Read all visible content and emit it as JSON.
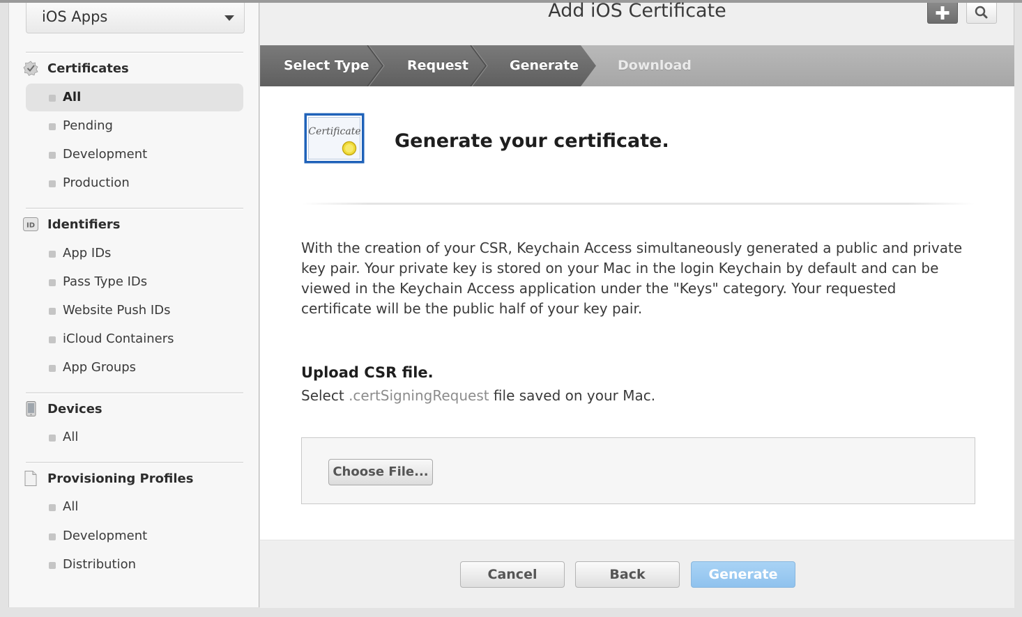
{
  "sidebar": {
    "app_selector": "iOS Apps",
    "sections": {
      "certificates": {
        "title": "Certificates",
        "items": [
          "All",
          "Pending",
          "Development",
          "Production"
        ]
      },
      "identifiers": {
        "title": "Identifiers",
        "icon_text": "ID",
        "items": [
          "App IDs",
          "Pass Type IDs",
          "Website Push IDs",
          "iCloud Containers",
          "App Groups"
        ]
      },
      "devices": {
        "title": "Devices",
        "items": [
          "All"
        ]
      },
      "provisioning": {
        "title": "Provisioning Profiles",
        "items": [
          "All",
          "Development",
          "Distribution"
        ]
      }
    },
    "active_item": "Certificates / All"
  },
  "header": {
    "title": "Add iOS Certificate",
    "add_icon": "plus-icon",
    "search_icon": "search-icon"
  },
  "steps": {
    "items": [
      "Select Type",
      "Request",
      "Generate",
      "Download"
    ],
    "current": "Generate"
  },
  "content": {
    "cert_icon_text": "Certificate",
    "title": "Generate your certificate.",
    "body_lines": [
      "With the creation of your CSR, Keychain Access simultaneously generated a public and private",
      "key pair. Your private key is stored on your Mac in the login Keychain by default and can be",
      "viewed in the Keychain Access application under the \"Keys\" category. Your requested",
      "certificate will be the public half of your key pair."
    ],
    "upload_title": "Upload CSR file.",
    "upload_sub_prefix": "Select ",
    "upload_sub_ext": ".certSigningRequest",
    "upload_sub_suffix": " file saved on your Mac.",
    "choose_file_label": "Choose File..."
  },
  "footer": {
    "cancel_label": "Cancel",
    "back_label": "Back",
    "generate_label": "Generate"
  },
  "colors": {
    "generate_button": "#8fc2ee",
    "step_active": "#666666",
    "step_pending": "#a8a8a8"
  }
}
